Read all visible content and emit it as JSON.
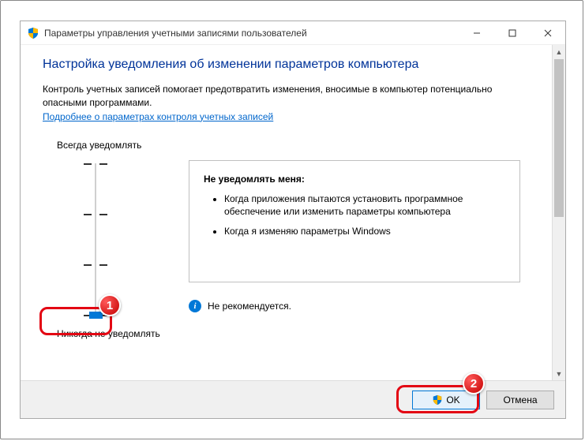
{
  "window": {
    "title": "Параметры управления учетными записями пользователей"
  },
  "content": {
    "heading": "Настройка уведомления об изменении параметров компьютера",
    "description": "Контроль учетных записей помогает предотвратить изменения, вносимые в компьютер потенциально опасными программами.",
    "link": "Подробнее о параметрах контроля учетных записей"
  },
  "slider": {
    "top_label": "Всегда уведомлять",
    "bottom_label": "Никогда не уведомлять"
  },
  "info": {
    "title": "Не уведомлять меня:",
    "items": [
      "Когда приложения пытаются установить программное обеспечение или изменить параметры компьютера",
      "Когда я изменяю параметры Windows"
    ],
    "recommendation": "Не рекомендуется."
  },
  "footer": {
    "ok": "OK",
    "cancel": "Отмена"
  },
  "annotations": {
    "badge1": "1",
    "badge2": "2"
  }
}
